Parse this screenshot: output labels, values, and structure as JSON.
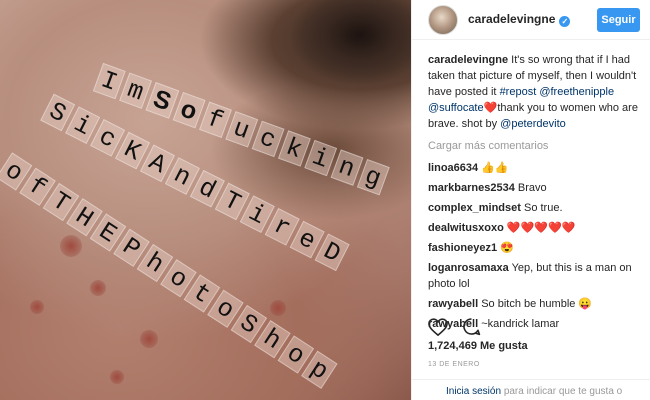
{
  "post": {
    "stickers": {
      "line1": [
        "I",
        "m",
        "S",
        "o",
        "f",
        "u",
        "c",
        "k",
        "i",
        "n",
        "g"
      ],
      "line2": [
        "S",
        "i",
        "c",
        "K",
        "A",
        "n",
        "d",
        "T",
        "i",
        "r",
        "e",
        "D"
      ],
      "line3": [
        "o",
        "f",
        "T",
        "H",
        "E",
        "P",
        "h",
        "o",
        "t",
        "o",
        "S",
        "h",
        "o",
        "p"
      ]
    }
  },
  "header": {
    "username": "caradelevingne",
    "verified_icon": "✓",
    "follow_label": "Seguir"
  },
  "caption": {
    "username": "caradelevingne",
    "text_1": "It's so wrong that if I had taken that picture of myself, then I wouldn't have posted it",
    "hashtag": "#repost",
    "mention_1": "@freethenipple",
    "mention_2": "@suffocate",
    "heart": "❤️",
    "text_2": "thank you to women who are brave. shot by",
    "mention_3": "@peterdevito"
  },
  "load_more": "Cargar más comentarios",
  "comments": [
    {
      "user": "linoa6634",
      "text": "👍👍"
    },
    {
      "user": "markbarnes2534",
      "text": "Bravo"
    },
    {
      "user": "complex_mindset",
      "text": "So true."
    },
    {
      "user": "dealwitusxoxo",
      "text": "❤️❤️❤️❤️❤️"
    },
    {
      "user": "fashioneyez1",
      "text": "😍"
    },
    {
      "user": "loganrosamaxa",
      "text": "Yep, but this is a man on photo lol"
    },
    {
      "user": "rawyabell",
      "text": "So bitch be humble 😛"
    },
    {
      "user": "rawyabell",
      "text": "~kandrick lamar"
    }
  ],
  "likes": "1,724,469 Me gusta",
  "date": "13 DE ENERO",
  "login": {
    "link": "Inicia sesión",
    "text": "para indicar que te gusta o"
  },
  "icons": {
    "like": "heart-icon",
    "comment": "comment-icon"
  }
}
